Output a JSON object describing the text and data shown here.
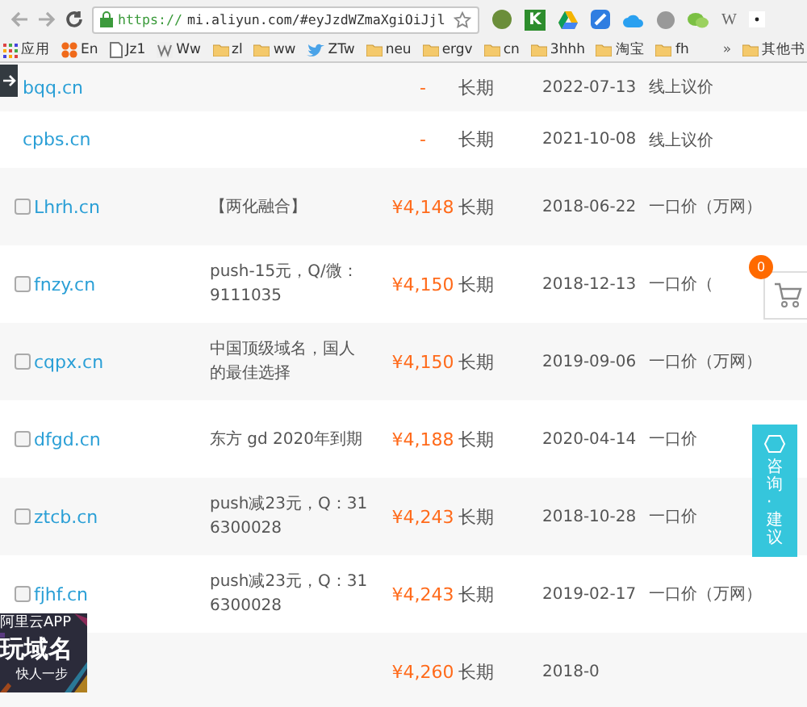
{
  "browser": {
    "url_scheme": "https://",
    "url_rest": "mi.aliyun.com/#eyJzdWZmaXgiOiJjl",
    "extensions": [
      {
        "kind": "round"
      },
      {
        "kind": "badge",
        "label": "K"
      },
      {
        "kind": "triangle"
      },
      {
        "kind": "square"
      },
      {
        "kind": "cloud"
      },
      {
        "kind": "dot"
      },
      {
        "kind": "chat"
      },
      {
        "kind": "letter",
        "label": "W"
      },
      {
        "kind": "menu"
      }
    ],
    "bookmarks": [
      {
        "kind": "apps",
        "label": "应用"
      },
      {
        "kind": "grid",
        "label": "En"
      },
      {
        "kind": "page",
        "label": "Jz1"
      },
      {
        "kind": "w",
        "label": "Ww"
      },
      {
        "kind": "folder",
        "label": "zl"
      },
      {
        "kind": "folder",
        "label": "ww"
      },
      {
        "kind": "bird",
        "label": "ZTw"
      },
      {
        "kind": "folder",
        "label": "neu"
      },
      {
        "kind": "folder",
        "label": "ergv"
      },
      {
        "kind": "folder",
        "label": "cn"
      },
      {
        "kind": "folder",
        "label": "3hhh"
      },
      {
        "kind": "folder",
        "label": "淘宝"
      },
      {
        "kind": "folder",
        "label": "fh"
      }
    ],
    "overflow": "»",
    "other_bookmarks": "其他书"
  },
  "rows": [
    {
      "domain": "bqq.cn",
      "note_lines": [],
      "price": "-",
      "term": "长期",
      "date": "2022-07-13",
      "price_type": "线上议价"
    },
    {
      "domain": "cpbs.cn",
      "note_lines": [],
      "price": "-",
      "term": "长期",
      "date": "2021-10-08",
      "price_type": "线上议价"
    },
    {
      "checked": false,
      "domain": "Lhrh.cn",
      "note_lines": [
        "【两化融合】"
      ],
      "price": "¥4,148",
      "term": "长期",
      "date": "2018-06-22",
      "price_type": "一口价（万网）"
    },
    {
      "checked": false,
      "domain": "fnzy.cn",
      "note_lines": [
        "push-15元，Q/微：",
        "9111035"
      ],
      "price": "¥4,150",
      "term": "长期",
      "date": "2018-12-13",
      "price_type": "一口价（"
    },
    {
      "checked": false,
      "domain": "cqpx.cn",
      "note_lines": [
        "中国顶级域名，国人",
        "的最佳选择"
      ],
      "price": "¥4,150",
      "term": "长期",
      "date": "2019-09-06",
      "price_type": "一口价（万网）"
    },
    {
      "checked": false,
      "domain": "dfgd.cn",
      "note_lines": [
        "东方 gd 2020年到期"
      ],
      "price": "¥4,188",
      "term": "长期",
      "date": "2020-04-14",
      "price_type": "一口价"
    },
    {
      "checked": false,
      "domain": "ztcb.cn",
      "note_lines": [
        "push减23元，Q：31",
        "6300028"
      ],
      "price": "¥4,243",
      "term": "长期",
      "date": "2018-10-28",
      "price_type": "一口价"
    },
    {
      "checked": false,
      "domain": "fjhf.cn",
      "note_lines": [
        "push减23元，Q：31",
        "6300028"
      ],
      "price": "¥4,243",
      "term": "长期",
      "date": "2019-02-17",
      "price_type": "一口价（万网）"
    },
    {
      "note_lines": [],
      "price": "¥4,260",
      "term": "长期",
      "date": "2018-0"
    }
  ],
  "cart": {
    "count": "0"
  },
  "consult": {
    "label": "咨询·建议"
  },
  "app_banner": {
    "title": "阿里云APP",
    "headline": "玩域名",
    "tagline": "快人一步"
  }
}
